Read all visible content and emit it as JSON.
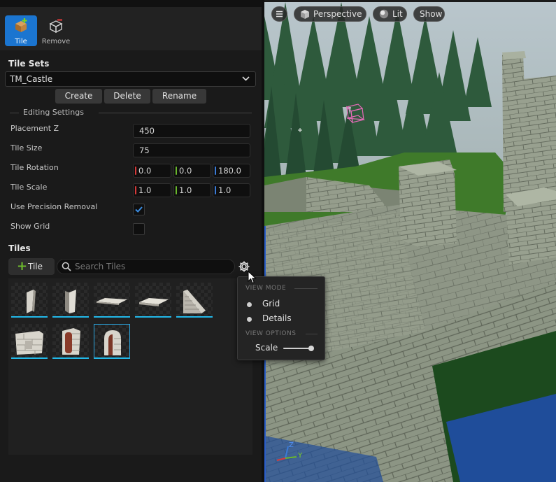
{
  "modes": [
    {
      "label": "Tile",
      "icon": "tile-icon",
      "active": true
    },
    {
      "label": "Remove",
      "icon": "cube-icon",
      "active": false
    }
  ],
  "tile_sets": {
    "title": "Tile Sets",
    "selected": "TM_Castle",
    "buttons": {
      "create": "Create",
      "delete": "Delete",
      "rename": "Rename"
    }
  },
  "editing": {
    "title": "Editing Settings",
    "placement_z": {
      "label": "Placement Z",
      "value": "450"
    },
    "tile_size": {
      "label": "Tile Size",
      "value": "75"
    },
    "tile_rotation": {
      "label": "Tile Rotation",
      "x": "0.0",
      "y": "0.0",
      "z": "180.0"
    },
    "tile_scale": {
      "label": "Tile Scale",
      "x": "1.0",
      "y": "1.0",
      "z": "1.0"
    },
    "use_precision_removal": {
      "label": "Use Precision Removal",
      "checked": true
    },
    "show_grid": {
      "label": "Show Grid",
      "checked": false
    }
  },
  "tiles": {
    "title": "Tiles",
    "add_label": "Tile",
    "search_placeholder": "Search Tiles",
    "items": [
      "wall-thin-1",
      "wall-thin-2",
      "floor-flat-1",
      "floor-flat-2",
      "stairs",
      "wall-block",
      "wall-pillar",
      "wall-arch"
    ],
    "selected_index": 7
  },
  "view_popup": {
    "view_mode_title": "VIEW MODE",
    "view_modes": [
      "Grid",
      "Details"
    ],
    "view_options_title": "VIEW OPTIONS",
    "scale_label": "Scale",
    "scale_value": 0.9
  },
  "viewport": {
    "menu_icon": "hamburger-icon",
    "perspective_label": "Perspective",
    "lit_label": "Lit",
    "show_label": "Show",
    "axis_labels": {
      "z": "Z",
      "y": "Y"
    }
  },
  "colors": {
    "accent": "#1b75d0",
    "axis_x": "#d83a3a",
    "axis_y": "#6ab82c",
    "axis_z": "#3a7bd8",
    "tile_underline": "#22b8e8",
    "add_plus": "#6dbb2d"
  }
}
